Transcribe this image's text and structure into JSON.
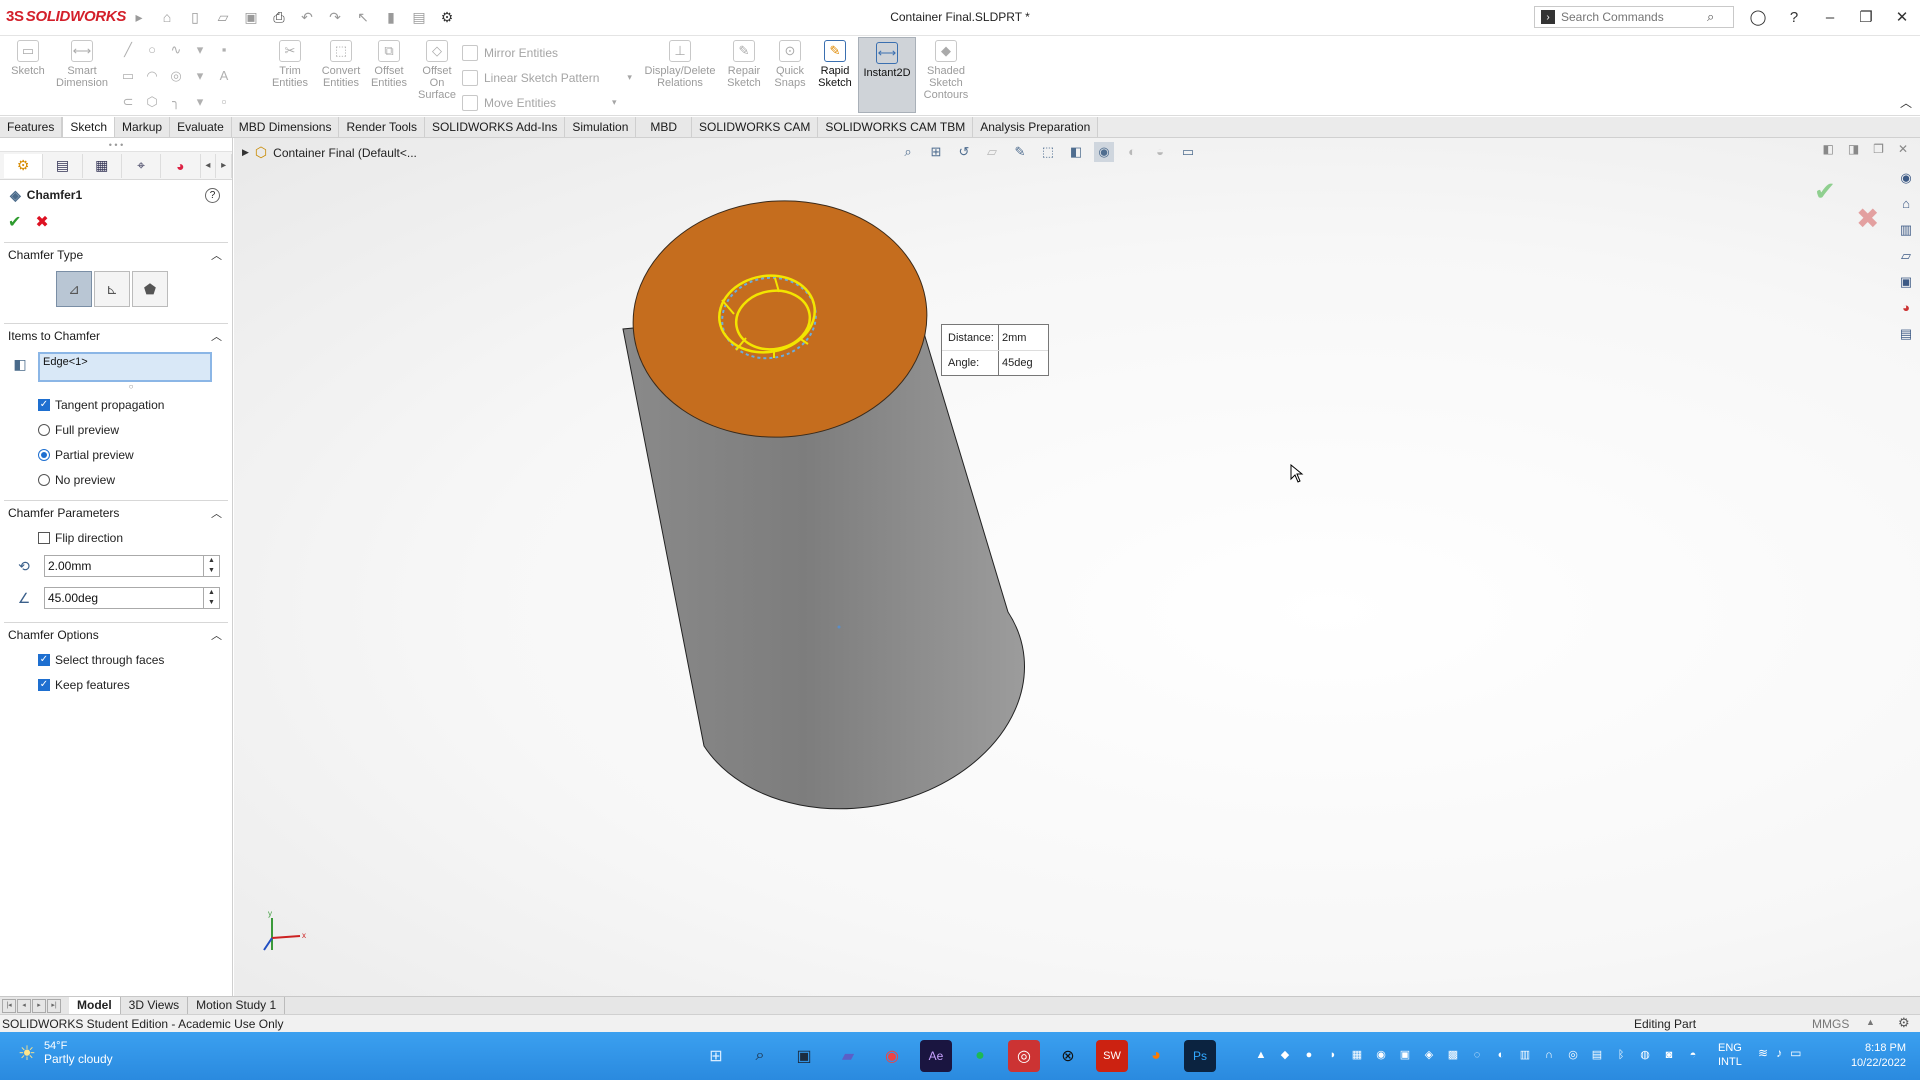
{
  "app": {
    "logo_ds": "3S",
    "logo_text": "SOLIDWORKS",
    "doc_title": "Container Final.SLDPRT *",
    "search_placeholder": "Search Commands"
  },
  "ribbon": {
    "buttons": [
      {
        "label_1": "Sketch",
        "label_2": "",
        "icon": "sketch-icon"
      },
      {
        "label_1": "Smart",
        "label_2": "Dimension",
        "icon": "smart-dimension-icon"
      },
      {
        "label_1": "Trim",
        "label_2": "Entities",
        "icon": "trim-icon"
      },
      {
        "label_1": "Convert",
        "label_2": "Entities",
        "icon": "convert-icon"
      },
      {
        "label_1": "Offset",
        "label_2": "Entities",
        "icon": "offset-icon"
      },
      {
        "label_1": "Offset",
        "label_2": "On",
        "label_3": "Surface",
        "icon": "offset-surface-icon"
      },
      {
        "label_1": "Display/Delete",
        "label_2": "Relations",
        "icon": "relations-icon"
      },
      {
        "label_1": "Repair",
        "label_2": "Sketch",
        "icon": "repair-icon"
      },
      {
        "label_1": "Quick",
        "label_2": "Snaps",
        "icon": "snaps-icon"
      },
      {
        "label_1": "Rapid",
        "label_2": "Sketch",
        "icon": "rapid-sketch-icon"
      },
      {
        "label_1": "Instant2D",
        "label_2": "",
        "icon": "instant2d-icon"
      },
      {
        "label_1": "Shaded",
        "label_2": "Sketch",
        "label_3": "Contours",
        "icon": "shaded-contours-icon"
      }
    ],
    "text_tools": [
      "Mirror Entities",
      "Linear Sketch Pattern",
      "Move Entities"
    ]
  },
  "tabs": [
    "Features",
    "Sketch",
    "Markup",
    "Evaluate",
    "MBD Dimensions",
    "Render Tools",
    "SOLIDWORKS Add-Ins",
    "Simulation",
    "MBD",
    "SOLIDWORKS CAM",
    "SOLIDWORKS CAM TBM",
    "Analysis Preparation"
  ],
  "active_tab": "Sketch",
  "property_manager": {
    "title": "Chamfer1",
    "chamfer_type": {
      "heading": "Chamfer Type"
    },
    "items": {
      "heading": "Items to Chamfer",
      "selection": "Edge<1>",
      "tangent_propagation": "Tangent propagation",
      "full_preview": "Full preview",
      "partial_preview": "Partial preview",
      "no_preview": "No preview"
    },
    "parameters": {
      "heading": "Chamfer Parameters",
      "flip_direction": "Flip direction",
      "distance_value": "2.00mm",
      "angle_value": "45.00deg"
    },
    "options": {
      "heading": "Chamfer Options",
      "select_through_faces": "Select through faces",
      "keep_features": "Keep features"
    }
  },
  "viewport": {
    "tree_label": "Container Final  (Default<...",
    "callout": {
      "distance_label": "Distance:",
      "distance_value": "2mm",
      "angle_label": "Angle:",
      "angle_value": "45deg"
    },
    "top_face_color": "#c56d1e",
    "body_color": "#8f8f8f",
    "highlight_color": "#f3e500",
    "triad_x": "x",
    "triad_y": "y"
  },
  "bottom_tabs": [
    "Model",
    "3D Views",
    "Motion Study 1"
  ],
  "status": {
    "left": "SOLIDWORKS Student Edition - Academic Use Only",
    "mode": "Editing Part",
    "units": "MMGS"
  },
  "taskbar": {
    "temperature": "54°F",
    "weather": "Partly cloudy",
    "lang_1": "ENG",
    "lang_2": "INTL",
    "time": "8:18 PM",
    "date": "10/22/2022"
  }
}
